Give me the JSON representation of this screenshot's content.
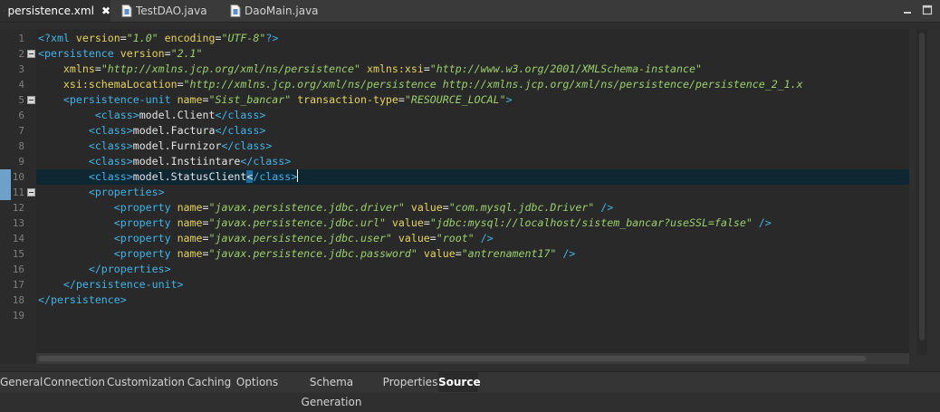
{
  "tabs": [
    {
      "label": "persistence.xml",
      "active": true,
      "close": "✖"
    },
    {
      "label": "TestDAO.java",
      "active": false
    },
    {
      "label": "DaoMain.java",
      "active": false
    }
  ],
  "editor": {
    "line_numbers": [
      "1",
      "2",
      "3",
      "4",
      "5",
      "6",
      "7",
      "8",
      "9",
      "10",
      "11",
      "12",
      "13",
      "14",
      "15",
      "16",
      "17",
      "18",
      "19"
    ],
    "lines": [
      [
        [
          "tag",
          "<?xml "
        ],
        [
          "attr",
          "version"
        ],
        [
          "txt",
          "="
        ],
        [
          "val",
          "\"1.0\""
        ],
        [
          "txt",
          " "
        ],
        [
          "attr",
          "encoding"
        ],
        [
          "txt",
          "="
        ],
        [
          "val",
          "\"UTF-8\""
        ],
        [
          "tag",
          "?>"
        ]
      ],
      [
        [
          "tag",
          "<persistence "
        ],
        [
          "attr",
          "version"
        ],
        [
          "txt",
          "="
        ],
        [
          "val",
          "\"2.1\""
        ]
      ],
      [
        [
          "txt",
          "    "
        ],
        [
          "attr",
          "xmlns"
        ],
        [
          "txt",
          "="
        ],
        [
          "val",
          "\"http://xmlns.jcp.org/xml/ns/persistence\""
        ],
        [
          "txt",
          " "
        ],
        [
          "attr",
          "xmlns:xsi"
        ],
        [
          "txt",
          "="
        ],
        [
          "val",
          "\"http://www.w3.org/2001/XMLSchema-instance\""
        ]
      ],
      [
        [
          "txt",
          "    "
        ],
        [
          "attr",
          "xsi:schemaLocation"
        ],
        [
          "txt",
          "="
        ],
        [
          "val",
          "\"http://xmlns.jcp.org/xml/ns/persistence http://xmlns.jcp.org/xml/ns/persistence/persistence_2_1.x"
        ]
      ],
      [
        [
          "txt",
          "    "
        ],
        [
          "tag",
          "<persistence-unit "
        ],
        [
          "attr",
          "name"
        ],
        [
          "txt",
          "="
        ],
        [
          "val",
          "\"Sist_bancar\""
        ],
        [
          "txt",
          " "
        ],
        [
          "attr",
          "transaction-type"
        ],
        [
          "txt",
          "="
        ],
        [
          "val",
          "\"RESOURCE_LOCAL\""
        ],
        [
          "tag",
          ">"
        ]
      ],
      [
        [
          "txt",
          "         "
        ],
        [
          "tag",
          "<class>"
        ],
        [
          "txt",
          "model.Client"
        ],
        [
          "tag",
          "</class>"
        ]
      ],
      [
        [
          "txt",
          "        "
        ],
        [
          "tag",
          "<class>"
        ],
        [
          "txt",
          "model.Factura"
        ],
        [
          "tag",
          "</class>"
        ]
      ],
      [
        [
          "txt",
          "        "
        ],
        [
          "tag",
          "<class>"
        ],
        [
          "txt",
          "model.Furnizor"
        ],
        [
          "tag",
          "</class>"
        ]
      ],
      [
        [
          "txt",
          "        "
        ],
        [
          "tag",
          "<class>"
        ],
        [
          "txt",
          "model.Instiintare"
        ],
        [
          "tag",
          "</class>"
        ]
      ],
      [
        [
          "txt",
          "        "
        ],
        [
          "tag",
          "<class>"
        ],
        [
          "txt",
          "model.StatusClient"
        ],
        [
          "sel",
          "<"
        ],
        [
          "tag",
          "/class>"
        ],
        [
          "caret",
          ""
        ]
      ],
      [
        [
          "txt",
          "        "
        ],
        [
          "tag",
          "<properties>"
        ]
      ],
      [
        [
          "txt",
          "            "
        ],
        [
          "tag",
          "<property "
        ],
        [
          "attr",
          "name"
        ],
        [
          "txt",
          "="
        ],
        [
          "val",
          "\"javax.persistence.jdbc.driver\""
        ],
        [
          "txt",
          " "
        ],
        [
          "attr",
          "value"
        ],
        [
          "txt",
          "="
        ],
        [
          "val",
          "\"com.mysql.jdbc.Driver\""
        ],
        [
          "txt",
          " "
        ],
        [
          "tag",
          "/>"
        ]
      ],
      [
        [
          "txt",
          "            "
        ],
        [
          "tag",
          "<property "
        ],
        [
          "attr",
          "name"
        ],
        [
          "txt",
          "="
        ],
        [
          "val",
          "\"javax.persistence.jdbc.url\""
        ],
        [
          "txt",
          " "
        ],
        [
          "attr",
          "value"
        ],
        [
          "txt",
          "="
        ],
        [
          "val",
          "\"jdbc:mysql://localhost/sistem_bancar?useSSL=false\""
        ],
        [
          "txt",
          " "
        ],
        [
          "tag",
          "/>"
        ]
      ],
      [
        [
          "txt",
          "            "
        ],
        [
          "tag",
          "<property "
        ],
        [
          "attr",
          "name"
        ],
        [
          "txt",
          "="
        ],
        [
          "val",
          "\"javax.persistence.jdbc.user\""
        ],
        [
          "txt",
          " "
        ],
        [
          "attr",
          "value"
        ],
        [
          "txt",
          "="
        ],
        [
          "val",
          "\"root\""
        ],
        [
          "txt",
          " "
        ],
        [
          "tag",
          "/>"
        ]
      ],
      [
        [
          "txt",
          "            "
        ],
        [
          "tag",
          "<property "
        ],
        [
          "attr",
          "name"
        ],
        [
          "txt",
          "="
        ],
        [
          "val",
          "\"javax.persistence.jdbc.password\""
        ],
        [
          "txt",
          " "
        ],
        [
          "attr",
          "value"
        ],
        [
          "txt",
          "="
        ],
        [
          "val",
          "\"antrenament17\""
        ],
        [
          "txt",
          " "
        ],
        [
          "tag",
          "/>"
        ]
      ],
      [
        [
          "txt",
          "        "
        ],
        [
          "tag",
          "</properties>"
        ]
      ],
      [
        [
          "txt",
          "    "
        ],
        [
          "tag",
          "</persistence-unit>"
        ]
      ],
      [
        [
          "tag",
          "</persistence>"
        ]
      ],
      []
    ],
    "fold_lines": [
      2,
      5,
      11
    ],
    "change_marks": [
      10,
      11
    ],
    "current_line": 10
  },
  "page_tabs": [
    {
      "label": "General",
      "active": false
    },
    {
      "label": "Connection",
      "active": false
    },
    {
      "label": "Customization",
      "active": false
    },
    {
      "label": "Caching",
      "active": false
    },
    {
      "label": "Options",
      "active": false
    },
    {
      "label": "Schema Generation",
      "active": false
    },
    {
      "label": "Properties",
      "active": false
    },
    {
      "label": "Source",
      "active": true
    }
  ],
  "colors": {
    "tag": "#3fb5e8",
    "attribute": "#e6d35a",
    "value": "#9ad06a",
    "current_line": "#0f2733",
    "selection": "#1b6c9e"
  }
}
